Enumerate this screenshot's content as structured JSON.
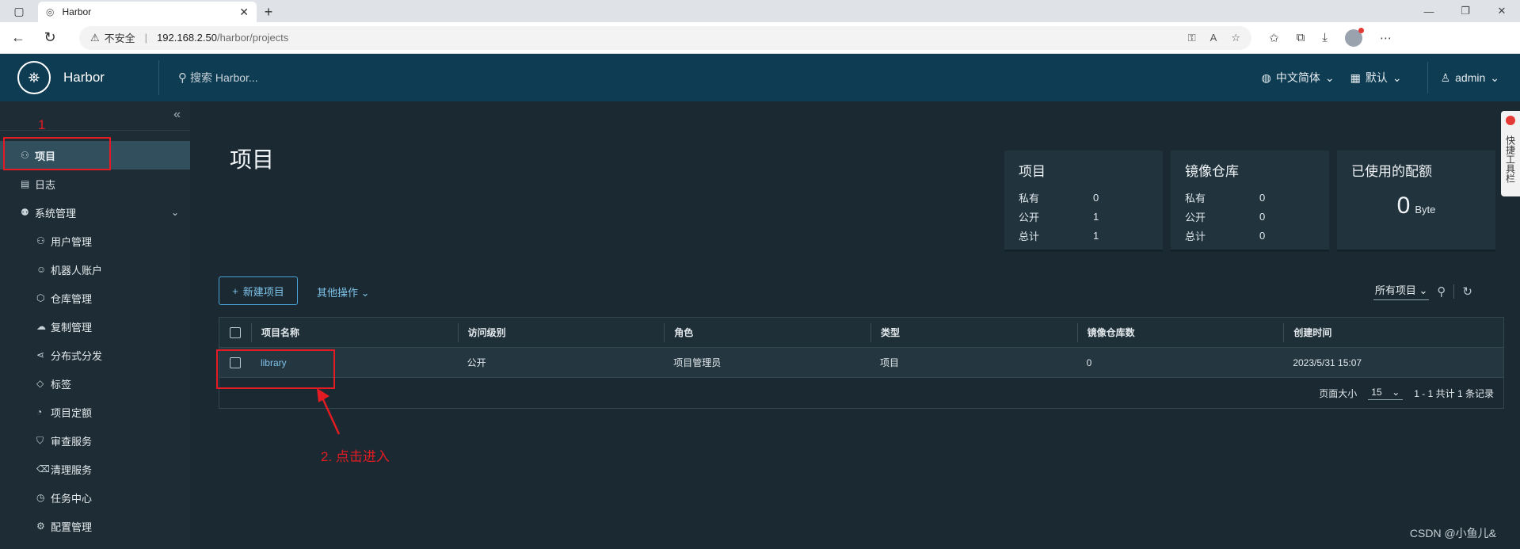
{
  "browser": {
    "tab_title": "Harbor",
    "insecure_label": "不安全",
    "url_host": "192.168.2.50",
    "url_path": "/harbor/projects"
  },
  "header": {
    "brand": "Harbor",
    "search_placeholder": "搜索 Harbor...",
    "language": "中文简体",
    "theme": "默认",
    "user": "admin"
  },
  "sidebar": {
    "items": [
      {
        "label": "项目",
        "icon": "projects-icon"
      },
      {
        "label": "日志",
        "icon": "log-icon"
      },
      {
        "label": "系统管理",
        "icon": "admin-icon"
      }
    ],
    "sub_items": [
      {
        "label": "用户管理",
        "icon": "users-icon"
      },
      {
        "label": "机器人账户",
        "icon": "robot-icon"
      },
      {
        "label": "仓库管理",
        "icon": "registry-icon"
      },
      {
        "label": "复制管理",
        "icon": "replication-icon"
      },
      {
        "label": "分布式分发",
        "icon": "distribution-icon"
      },
      {
        "label": "标签",
        "icon": "tag-icon"
      },
      {
        "label": "项目定额",
        "icon": "quota-icon"
      },
      {
        "label": "审查服务",
        "icon": "shield-icon"
      },
      {
        "label": "清理服务",
        "icon": "trash-icon"
      },
      {
        "label": "任务中心",
        "icon": "tasks-icon"
      },
      {
        "label": "配置管理",
        "icon": "gear-icon"
      }
    ]
  },
  "main": {
    "title": "项目",
    "cards": {
      "projects": {
        "title": "项目",
        "private_label": "私有",
        "private": "0",
        "public_label": "公开",
        "public": "1",
        "total_label": "总计",
        "total": "1"
      },
      "repos": {
        "title": "镜像仓库",
        "private_label": "私有",
        "private": "0",
        "public_label": "公开",
        "public": "0",
        "total_label": "总计",
        "total": "0"
      },
      "quota": {
        "title": "已使用的配额",
        "value": "0",
        "unit": "Byte"
      }
    },
    "new_project": "新建项目",
    "more_actions": "其他操作",
    "filter": "所有项目",
    "columns": [
      "项目名称",
      "访问级别",
      "角色",
      "类型",
      "镜像仓库数",
      "创建时间"
    ],
    "rows": [
      {
        "name": "library",
        "access": "公开",
        "role": "项目管理员",
        "type": "项目",
        "repo_count": "0",
        "created": "2023/5/31 15:07"
      }
    ],
    "page_size_label": "页面大小",
    "page_size": "15",
    "range": "1 - 1 共计 1 条记录"
  },
  "annotations": {
    "step1": "1",
    "step2": "2. 点击进入"
  },
  "side_tab": "快捷工具栏",
  "watermark": "CSDN @小鱼儿&",
  "colors": {
    "header_bg": "#0e3c52",
    "accent": "#7fc3ea",
    "annotation": "#e31b23"
  }
}
